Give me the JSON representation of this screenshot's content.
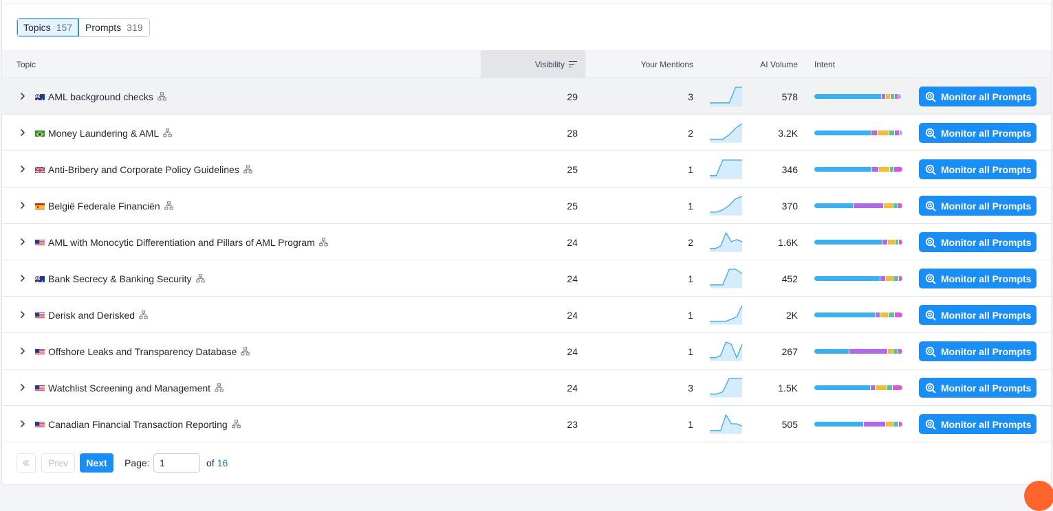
{
  "tabs": [
    {
      "label": "Topics",
      "count": "157"
    },
    {
      "label": "Prompts",
      "count": "319"
    }
  ],
  "table": {
    "headers": {
      "topic": "Topic",
      "visibility": "Visibility",
      "mentions": "Your Mentions",
      "volume": "AI Volume",
      "intent": "Intent"
    },
    "rows": [
      {
        "flag": "au",
        "topic": "AML background checks",
        "visibility": "29",
        "mentions": "3",
        "volume": "578",
        "spark": [
          1,
          1,
          1,
          1,
          8,
          8
        ],
        "intent": [
          0.79,
          0.04,
          0.05,
          0.04,
          0.03,
          0.03
        ],
        "action": "Monitor all Prompts"
      },
      {
        "flag": "br",
        "topic": "Money Laundering & AML",
        "visibility": "28",
        "mentions": "2",
        "volume": "3.2K",
        "spark": [
          1,
          1,
          1,
          3,
          6,
          8
        ],
        "intent": [
          0.67,
          0.06,
          0.13,
          0.06,
          0.05,
          0.03
        ],
        "action": "Monitor all Prompts"
      },
      {
        "flag": "gb",
        "topic": "Anti-Bribery and Corporate Policy Guidelines",
        "visibility": "25",
        "mentions": "1",
        "volume": "346",
        "spark": [
          1,
          1,
          8,
          8,
          8,
          8
        ],
        "intent": [
          0.67,
          0.07,
          0.12,
          0.04,
          0.1
        ],
        "action": "Monitor all Prompts"
      },
      {
        "flag": "es",
        "topic": "België Federale Financiën",
        "visibility": "25",
        "mentions": "1",
        "volume": "370",
        "spark": [
          1,
          1,
          2,
          4,
          7,
          8
        ],
        "intent": [
          0.45,
          0.35,
          0.1,
          0.05,
          0.05
        ],
        "action": "Monitor all Prompts"
      },
      {
        "flag": "us",
        "topic": "AML with Monocytic Differentiation and Pillars of AML Program",
        "visibility": "24",
        "mentions": "2",
        "volume": "1.6K",
        "spark": [
          1,
          1,
          2,
          8,
          4,
          5,
          4
        ],
        "intent": [
          0.79,
          0.06,
          0.08,
          0.03,
          0.04
        ],
        "action": "Monitor all Prompts"
      },
      {
        "flag": "au",
        "topic": "Bank Secrecy & Banking Security",
        "visibility": "24",
        "mentions": "1",
        "volume": "452",
        "spark": [
          1,
          1,
          1,
          8,
          8,
          6
        ],
        "intent": [
          0.77,
          0.05,
          0.08,
          0.06,
          0.04
        ],
        "action": "Monitor all Prompts"
      },
      {
        "flag": "us",
        "topic": "Derisk and Derisked",
        "visibility": "24",
        "mentions": "1",
        "volume": "2K",
        "spark": [
          1,
          1,
          1,
          1,
          2,
          3,
          8
        ],
        "intent": [
          0.71,
          0.05,
          0.09,
          0.06,
          0.09
        ],
        "action": "Monitor all Prompts"
      },
      {
        "flag": "us",
        "topic": "Offshore Leaks and Transparency Database",
        "visibility": "24",
        "mentions": "1",
        "volume": "267",
        "spark": [
          1,
          1,
          2,
          8,
          7,
          1,
          7
        ],
        "intent": [
          0.4,
          0.45,
          0.05,
          0.05,
          0.05
        ],
        "action": "Monitor all Prompts"
      },
      {
        "flag": "us",
        "topic": "Watchlist Screening and Management",
        "visibility": "24",
        "mentions": "3",
        "volume": "1.5K",
        "spark": [
          1,
          1,
          2,
          8,
          8,
          8
        ],
        "intent": [
          0.65,
          0.05,
          0.13,
          0.06,
          0.11
        ],
        "action": "Monitor all Prompts"
      },
      {
        "flag": "us",
        "topic": "Canadian Financial Transaction Reporting",
        "visibility": "23",
        "mentions": "1",
        "volume": "505",
        "spark": [
          1,
          1,
          1,
          8,
          4,
          4,
          3
        ],
        "intent": [
          0.57,
          0.25,
          0.08,
          0.06,
          0.04
        ],
        "action": "Monitor all Prompts"
      }
    ]
  },
  "pagination": {
    "prev": "Prev",
    "next": "Next",
    "page_label": "Page:",
    "current": "1",
    "of_label": "of",
    "total": "16"
  },
  "colors": {
    "accent": "#1a8ef5",
    "intent": [
      "#3bb0f0",
      "#b06ae8",
      "#f2bd3a",
      "#5ac39a",
      "#d65ae0",
      "#a9a9d4"
    ]
  }
}
